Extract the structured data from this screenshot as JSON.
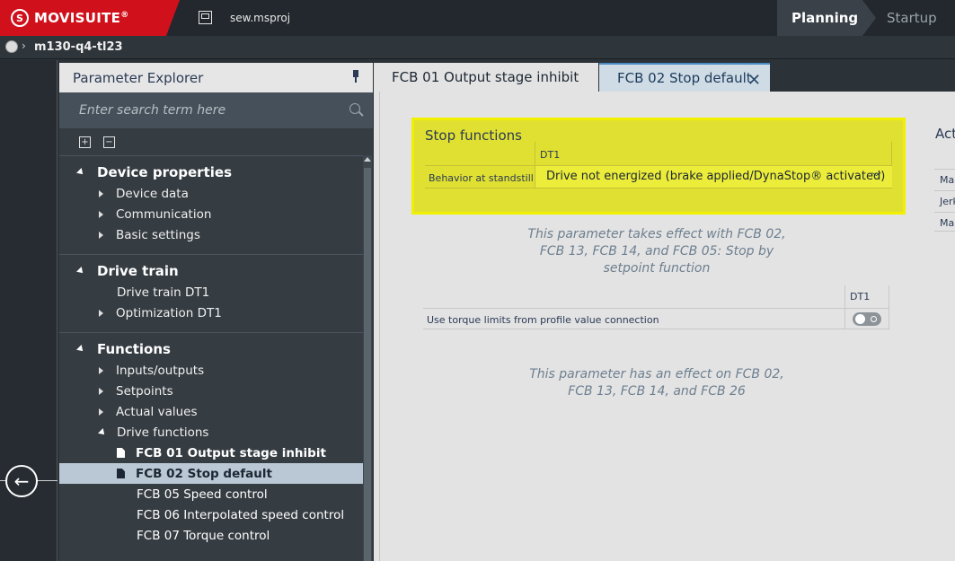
{
  "app": {
    "brand": "MOVISUITE",
    "brand_mark": "®",
    "filename": "sew.msproj"
  },
  "workflow": {
    "steps": [
      "Planning",
      "Startup"
    ],
    "active": "Planning"
  },
  "path": {
    "device": "m130-q4-tl23"
  },
  "explorer": {
    "title": "Parameter Explorer",
    "search_placeholder": "Enter search term here",
    "sections": [
      {
        "title": "Device properties",
        "items": [
          "Device data",
          "Communication",
          "Basic settings"
        ]
      },
      {
        "title": "Drive train",
        "items": [
          "Drive train DT1",
          "Optimization DT1"
        ]
      },
      {
        "title": "Functions",
        "items": [
          "Inputs/outputs",
          "Setpoints",
          "Actual values",
          "Drive functions"
        ],
        "leaves": [
          "FCB 01 Output stage inhibit",
          "FCB 02 Stop default",
          "FCB 05 Speed control",
          "FCB 06 Interpolated speed control",
          "FCB 07 Torque control"
        ]
      }
    ],
    "selected_leaf": "FCB 02 Stop default"
  },
  "tabs": [
    {
      "label": "FCB 01 Output stage inhibit",
      "active": false
    },
    {
      "label": "FCB 02 Stop default",
      "active": true
    }
  ],
  "stop_functions": {
    "title": "Stop functions",
    "column": "DT1",
    "row_label": "Behavior at standstill",
    "value": "Drive not energized (brake applied/DynaStop® activated)",
    "highlight_color": "#e0e032"
  },
  "info1": "This parameter takes effect with FCB 02, FCB 13, FCB 14, and FCB 05: Stop by setpoint function",
  "torque": {
    "column": "DT1",
    "row_label": "Use torque limits from profile value connection",
    "toggle_on": false
  },
  "info2": "This parameter has an effect on FCB 02, FCB 13, FCB 14, and FCB 26",
  "activation": {
    "title_partial": "Act",
    "rows": [
      "Ma",
      "Jerk",
      "Ma"
    ]
  }
}
